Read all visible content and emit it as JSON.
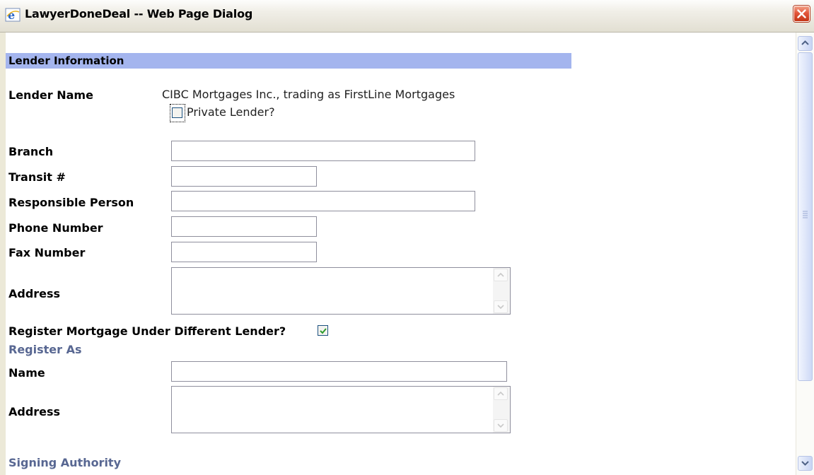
{
  "window": {
    "title": "LawyerDoneDeal -- Web Page Dialog",
    "icon": "ie-browser-icon",
    "close_icon": "close-icon"
  },
  "section": {
    "title": "Lender Information"
  },
  "lender": {
    "name_label": "Lender Name",
    "name_value": "CIBC Mortgages Inc., trading as FirstLine Mortgages",
    "private_label": "Private Lender?",
    "private_checked": false
  },
  "fields": {
    "branch": {
      "label": "Branch",
      "value": ""
    },
    "transit": {
      "label": "Transit #",
      "value": ""
    },
    "responsible": {
      "label": "Responsible Person",
      "value": ""
    },
    "phone": {
      "label": "Phone Number",
      "value": ""
    },
    "fax": {
      "label": "Fax Number",
      "value": ""
    },
    "address": {
      "label": "Address",
      "value": ""
    }
  },
  "register": {
    "question": "Register Mortgage Under Different Lender?",
    "checked": true,
    "heading": "Register As",
    "name_label": "Name",
    "name_value": "",
    "address_label": "Address",
    "address_value": ""
  },
  "signing": {
    "heading": "Signing Authority"
  },
  "colors": {
    "section_bar": "#a4b5ee",
    "subheading": "#586792",
    "close_button": "#e2553a",
    "check_mark": "#2d9c2d"
  }
}
